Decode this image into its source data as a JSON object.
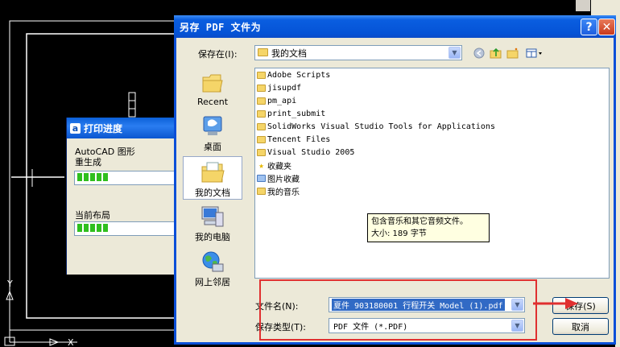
{
  "cad": {
    "ucs_y_label": "Y",
    "ucs_x_label": "X"
  },
  "progress_dialog": {
    "title": "打印进度",
    "title_icon": "a",
    "line1": "AutoCAD 图形",
    "line2": "重生成",
    "line3": "当前布局",
    "bar1_fraction": 1,
    "bar2_fraction": 1
  },
  "save_dialog": {
    "title": "另存 PDF 文件为",
    "help_label": "?",
    "close_label": "✕",
    "save_in_label": "保存在(I):",
    "save_in_value": "我的文档",
    "places": [
      {
        "label": "Recent",
        "icon": "recent-folder-icon"
      },
      {
        "label": "桌面",
        "icon": "desktop-icon"
      },
      {
        "label": "我的文档",
        "icon": "my-documents-icon"
      },
      {
        "label": "我的电脑",
        "icon": "my-computer-icon"
      },
      {
        "label": "网上邻居",
        "icon": "network-places-icon"
      }
    ],
    "files": [
      {
        "name": "Adobe Scripts",
        "icon": "folder"
      },
      {
        "name": "jisupdf",
        "icon": "folder"
      },
      {
        "name": "pm_api",
        "icon": "folder"
      },
      {
        "name": "print_submit",
        "icon": "folder"
      },
      {
        "name": "SolidWorks Visual Studio Tools for Applications",
        "icon": "folder"
      },
      {
        "name": "Tencent Files",
        "icon": "folder"
      },
      {
        "name": "Visual Studio 2005",
        "icon": "folder"
      },
      {
        "name": "收藏夹",
        "icon": "favorites"
      },
      {
        "name": "图片收藏",
        "icon": "pictures"
      },
      {
        "name": "我的音乐",
        "icon": "music"
      }
    ],
    "tooltip_line1": "包含音乐和其它音频文件。",
    "tooltip_line2": "大小: 189 字节",
    "filename_label": "文件名(N):",
    "filename_value": "夏件 903180001 行程开关 Model (1).pdf",
    "filetype_label": "保存类型(T):",
    "filetype_value": "PDF 文件 (*.PDF)",
    "save_button": "保存(S)",
    "cancel_button": "取消"
  },
  "colors": {
    "xp_blue": "#0a5ee0",
    "selection": "#316ac5",
    "annotation_red": "#e03030",
    "progress_green": "#2fbf1e"
  }
}
